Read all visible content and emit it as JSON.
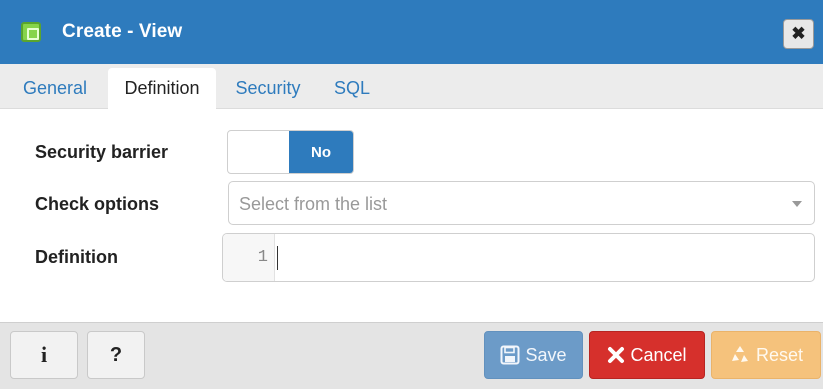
{
  "dialog": {
    "title": "Create - View",
    "close_glyph": "✖",
    "icon": "view-icon"
  },
  "tabs": [
    {
      "label": "General",
      "active": false
    },
    {
      "label": "Definition",
      "active": true
    },
    {
      "label": "Security",
      "active": false
    },
    {
      "label": "SQL",
      "active": false
    }
  ],
  "form": {
    "security_barrier": {
      "label": "Security barrier",
      "toggle_value": "No"
    },
    "check_options": {
      "label": "Check options",
      "placeholder": "Select from the list"
    },
    "definition": {
      "label": "Definition",
      "line_number": "1",
      "value": ""
    }
  },
  "footer": {
    "info_label": "i",
    "help_label": "?",
    "save_label": "Save",
    "cancel_label": "Cancel",
    "reset_label": "Reset"
  },
  "colors": {
    "titlebar": "#2e7bbd",
    "accent": "#2e7bbd",
    "save": "#6c9bc8",
    "cancel": "#d6302c",
    "reset": "#f5c27c"
  }
}
